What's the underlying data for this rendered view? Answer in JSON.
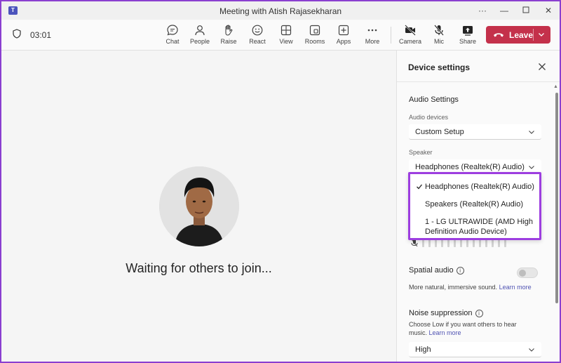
{
  "window": {
    "title": "Meeting with Atish Rajasekharan",
    "logo_letter": "T"
  },
  "toolbar": {
    "timer": "03:01",
    "buttons": {
      "chat": "Chat",
      "people": "People",
      "raise": "Raise",
      "react": "React",
      "view": "View",
      "rooms": "Rooms",
      "apps": "Apps",
      "more": "More",
      "camera": "Camera",
      "mic": "Mic",
      "share": "Share"
    },
    "leave": "Leave"
  },
  "stage": {
    "waiting_text": "Waiting for others to join..."
  },
  "panel": {
    "title": "Device settings",
    "audio_settings": "Audio Settings",
    "audio_devices_label": "Audio devices",
    "audio_devices_value": "Custom Setup",
    "speaker_label": "Speaker",
    "speaker_value": "Headphones (Realtek(R) Audio)",
    "speaker_options": [
      {
        "label": "Headphones (Realtek(R) Audio)",
        "selected": true
      },
      {
        "label": "Speakers (Realtek(R) Audio)",
        "selected": false
      },
      {
        "label_line1": "1 - LG ULTRAWIDE (AMD High",
        "label_line2": "Definition Audio Device)",
        "selected": false
      }
    ],
    "spatial_audio": "Spatial audio",
    "spatial_desc": "More natural, immersive sound.",
    "learn_more": "Learn more",
    "noise_suppression": "Noise suppression",
    "noise_desc_line1": "Choose Low if you want others to hear",
    "noise_desc_line2": "music.",
    "noise_value": "High"
  },
  "colors": {
    "leave": "#c4314b",
    "highlight_border": "#9d3ee0",
    "link": "#4f52b2"
  }
}
